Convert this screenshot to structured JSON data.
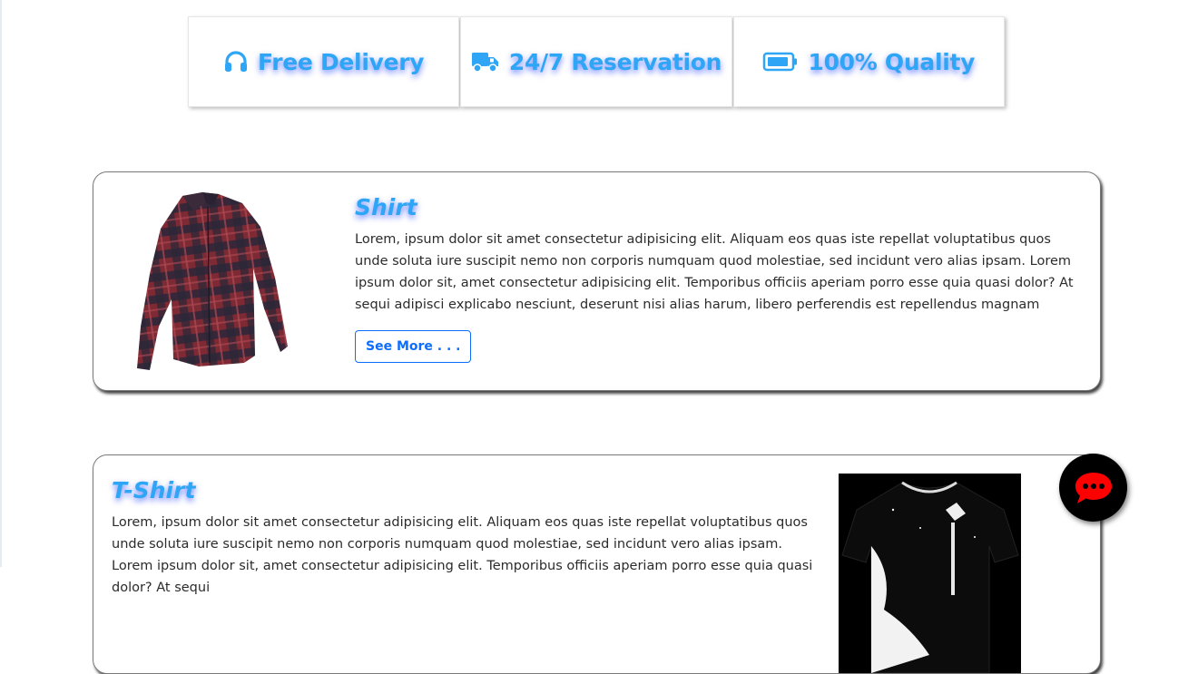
{
  "features": [
    {
      "label": "Free Delivery",
      "icon": "headphones-icon"
    },
    {
      "label": "24/7 Reservation",
      "icon": "truck-icon"
    },
    {
      "label": "100% Quality",
      "icon": "battery-icon"
    }
  ],
  "products": [
    {
      "title": "Shirt",
      "description": "Lorem, ipsum dolor sit amet consectetur adipisicing elit. Aliquam eos quas iste repellat voluptatibus quos unde soluta iure suscipit nemo non corporis numquam quod molestiae, sed incidunt vero alias ipsam. Lorem ipsum dolor sit, amet consectetur adipisicing elit. Temporibus officiis aperiam porro esse quia quasi dolor? At sequi adipisci explicabo nesciunt, deserunt nisi alias harum, libero perferendis est repellendus magnam",
      "button": "See More . . .",
      "image": "plaid-shirt"
    },
    {
      "title": "T-Shirt",
      "description": "Lorem, ipsum dolor sit amet consectetur adipisicing elit. Aliquam eos quas iste repellat voluptatibus quos unde soluta iure suscipit nemo non corporis numquam quod molestiae, sed incidunt vero alias ipsam. Lorem ipsum dolor sit, amet consectetur adipisicing elit. Temporibus officiis aperiam porro esse quia quasi dolor? At sequi",
      "image": "black-tshirt"
    }
  ],
  "chat": {
    "icon": "chat-bubble-icon"
  },
  "colors": {
    "accent": "#2fa6f5",
    "button": "#0d6efd",
    "chat_icon": "#ff0000"
  }
}
